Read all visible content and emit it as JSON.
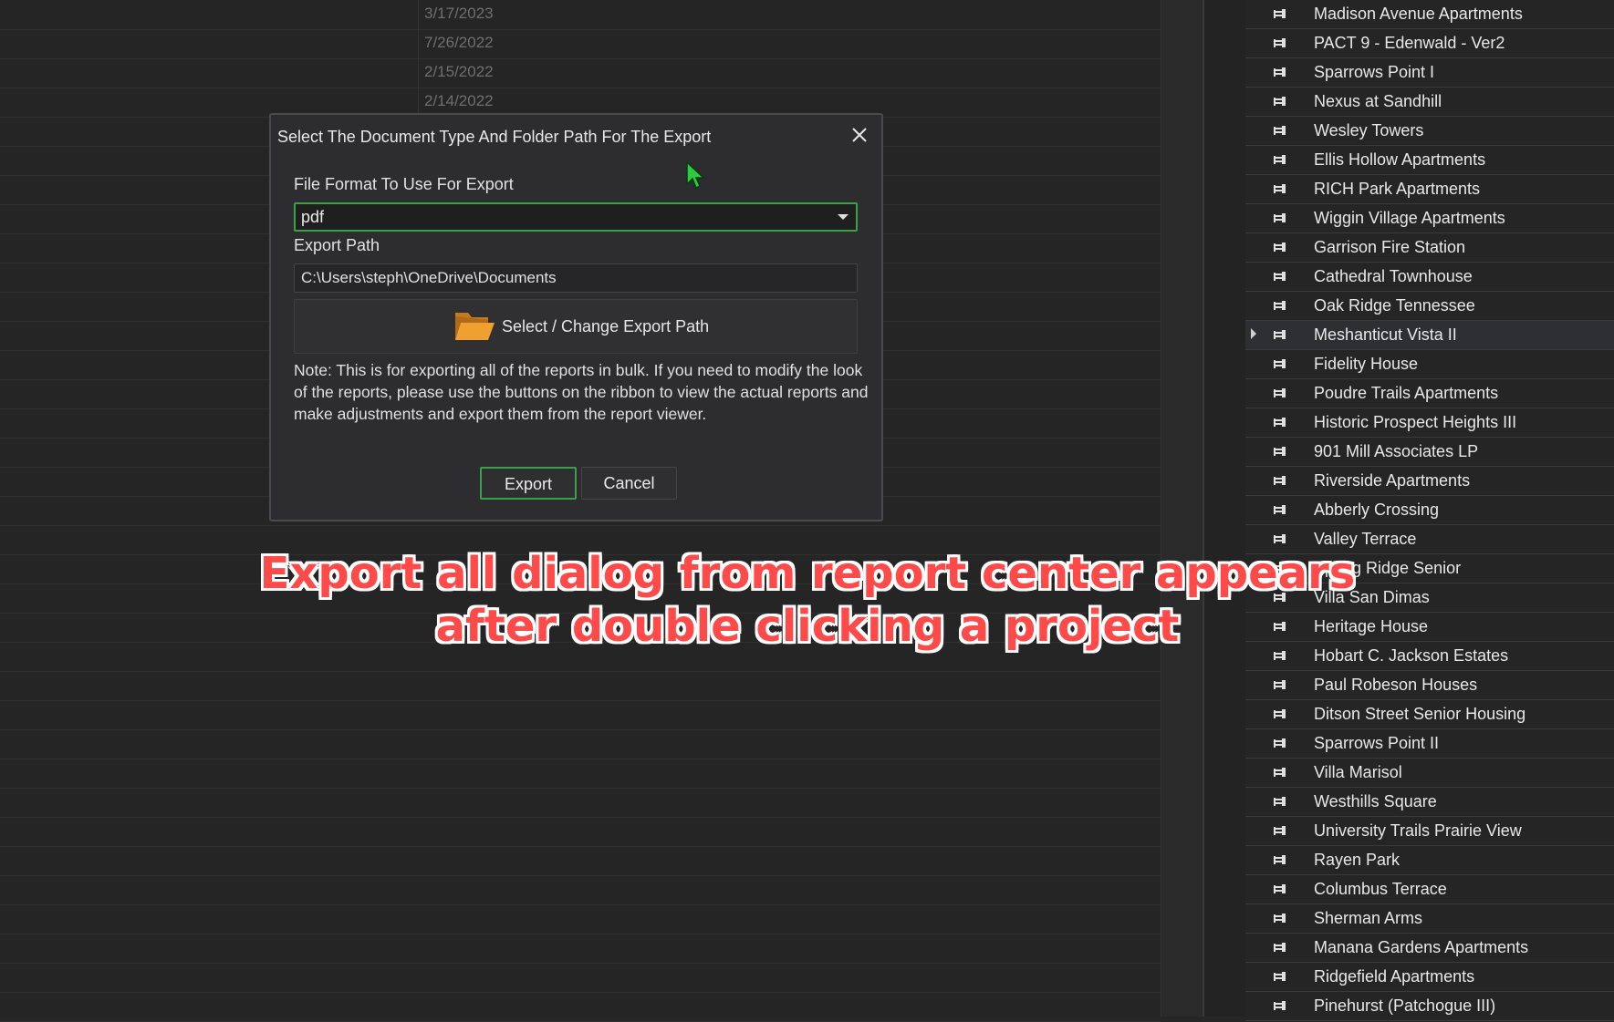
{
  "background_dates": [
    "3/17/2023",
    "7/26/2022",
    "2/15/2022",
    "2/14/2022"
  ],
  "projects": [
    "Madison Avenue Apartments",
    "PACT 9 - Edenwald - Ver2",
    "Sparrows Point I",
    "Nexus at Sandhill",
    "Wesley Towers",
    "Ellis Hollow Apartments",
    "RICH Park Apartments",
    "Wiggin Village Apartments",
    "Garrison Fire Station",
    "Cathedral Townhouse",
    "Oak Ridge Tennessee",
    "Meshanticut Vista II",
    "Fidelity House",
    "Poudre Trails Apartments",
    "Historic Prospect Heights III",
    "901 Mill Associates LP",
    "Riverside Apartments",
    "Abberly Crossing",
    "Valley Terrace",
    "Spring Ridge Senior",
    "Villa San Dimas",
    "Heritage House",
    "Hobart C. Jackson Estates",
    "Paul Robeson Houses",
    "Ditson Street Senior Housing",
    "Sparrows Point II",
    "Villa Marisol",
    "Westhills Square",
    "University Trails Prairie View",
    "Rayen Park",
    "Columbus Terrace",
    "Sherman Arms",
    "Manana Gardens Apartments",
    "Ridgefield Apartments",
    "Pinehurst (Patchogue III)"
  ],
  "selected_project": "Meshanticut Vista II",
  "dialog": {
    "title": "Select The Document Type And Folder Path For The Export",
    "format_label": "File Format To Use For Export",
    "format_value": "pdf",
    "path_label": "Export Path",
    "path_value": "C:\\Users\\steph\\OneDrive\\Documents",
    "path_button_label": "Select / Change Export Path",
    "note": "Note: This is for exporting all of the reports in bulk. If you need to modify the look of the reports, please use the buttons on the ribbon to view the actual reports and make adjustments and export them from the report viewer.",
    "export_label": "Export",
    "cancel_label": "Cancel"
  },
  "annotation": {
    "line1": "Export all dialog from report center appears",
    "line2": "after double clicking a project"
  },
  "colors": {
    "accent_green": "#3aa04a",
    "annotation_red": "#ff4a4a",
    "folder_orange": "#f0a030"
  }
}
